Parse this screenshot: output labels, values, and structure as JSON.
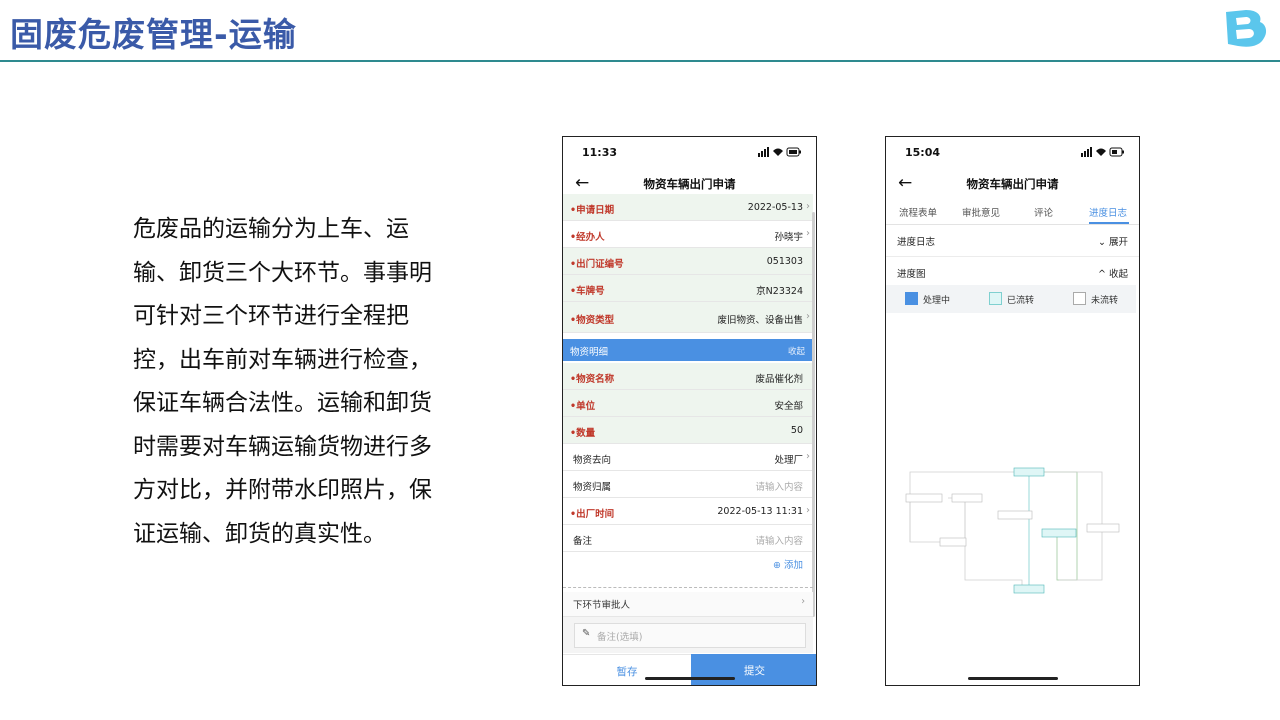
{
  "slide": {
    "title": "固废危废管理-运输",
    "description": "危废品的运输分为上车、运输、卸货三个大环节。事事明可针对三个环节进行全程把控，出车前对车辆进行检查，保证车辆合法性。运输和卸货时需要对车辆运输货物进行多方对比，并附带水印照片，保证运输、卸货的真实性。"
  },
  "phone1": {
    "time": "11:33",
    "title": "物资车辆出门申请",
    "fields": [
      {
        "label": "申请日期",
        "value": "2022-05-13"
      },
      {
        "label": "经办人",
        "value": "孙晓宇"
      },
      {
        "label": "出门证编号",
        "value": "051303"
      },
      {
        "label": "车牌号",
        "value": "京N23324"
      },
      {
        "label": "物资类型",
        "value": "废旧物资、设备出售"
      }
    ],
    "section": {
      "label": "物资明细",
      "action": "收起"
    },
    "details": [
      {
        "label": "物资名称",
        "value": "废品催化剂"
      },
      {
        "label": "单位",
        "value": "安全部"
      },
      {
        "label": "数量",
        "value": "50"
      },
      {
        "label": "物资去向",
        "value": "处理厂"
      },
      {
        "label": "物资归属",
        "value": "请输入内容"
      },
      {
        "label": "出厂时间",
        "value": "2022-05-13 11:31"
      },
      {
        "label": "备注",
        "value": "请输入内容"
      }
    ],
    "add_label": "⊕ 添加",
    "next_approver": "下环节审批人",
    "note_placeholder": "备注(选填)",
    "save_label": "暂存",
    "submit_label": "提交"
  },
  "phone2": {
    "time": "15:04",
    "title": "物资车辆出门申请",
    "tabs": [
      "流程表单",
      "审批意见",
      "评论",
      "进度日志"
    ],
    "progress_log": {
      "label": "进度日志",
      "action": "展开"
    },
    "progress_chart": {
      "label": "进度图",
      "action": "收起"
    },
    "legend": [
      {
        "label": "处理中",
        "color": "#4a90e2"
      },
      {
        "label": "已流转",
        "color": "#dff6f6"
      },
      {
        "label": "未流转",
        "color": "#ffffff"
      }
    ]
  },
  "colors": {
    "accent": "#4a90e2",
    "title": "#3a5aa8",
    "required": "#c0392b",
    "rule": "#2e8a8f"
  }
}
